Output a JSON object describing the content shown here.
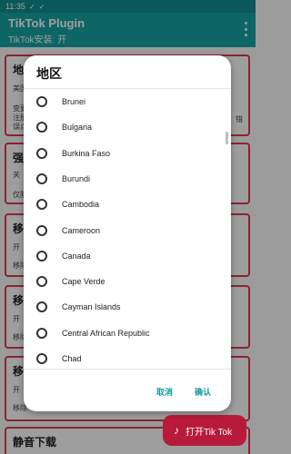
{
  "status_bar": {
    "time": "11:35"
  },
  "app_bar": {
    "title": "TikTok Plugin",
    "subtitle": "TikTok安装: 开"
  },
  "background_cards": [
    {
      "title": "地",
      "lines": [
        "美国",
        "变更",
        "注册",
        "误点"
      ],
      "right_text": "错"
    },
    {
      "title": "强",
      "lines": [
        "关",
        "仅限"
      ]
    },
    {
      "title": "移",
      "lines": [
        "开",
        "移除"
      ]
    },
    {
      "title": "移",
      "lines": [
        "开",
        "移除"
      ]
    },
    {
      "title": "移",
      "lines": [
        "开",
        "移除"
      ]
    },
    {
      "title": "静音下载",
      "lines": []
    }
  ],
  "fab": {
    "icon": "tiktok-icon",
    "label": "打开Tik Tok"
  },
  "dialog": {
    "title": "地区",
    "options": [
      "Brunei",
      "Bulgaria",
      "Burkina Faso",
      "Burundi",
      "Cambodia",
      "Cameroon",
      "Canada",
      "Cape Verde",
      "Cayman Islands",
      "Central African Republic",
      "Chad"
    ],
    "cancel_label": "取消",
    "confirm_label": "确认"
  }
}
